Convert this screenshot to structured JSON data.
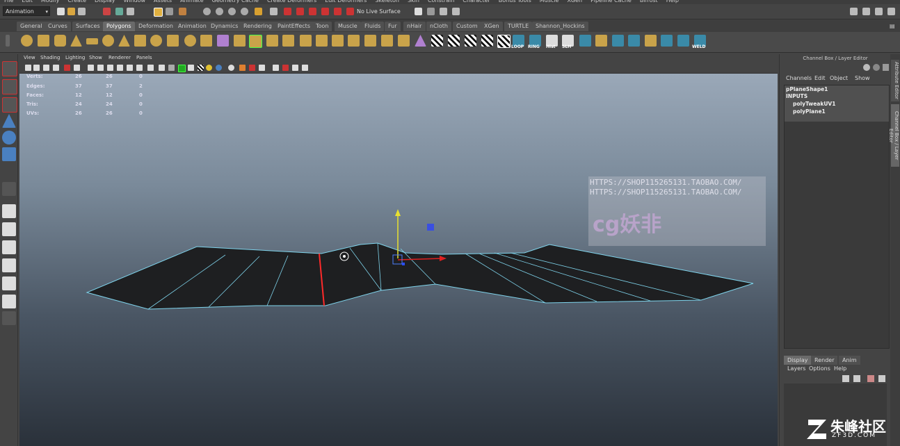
{
  "menubar": [
    "File",
    "Edit",
    "Modify",
    "Create",
    "Display",
    "Window",
    "Assets",
    "Animate",
    "Geometry Cache",
    "Create Deformers",
    "Edit Deformers",
    "Skeleton",
    "Skin",
    "Constrain",
    "Character",
    "Bonus Tools",
    "Muscle",
    "XGen",
    "Pipeline Cache",
    "Bifrost",
    "Help"
  ],
  "status": {
    "mode": "Animation",
    "live_surface": "No Live Surface"
  },
  "shelf_tabs": [
    "General",
    "Curves",
    "Surfaces",
    "Polygons",
    "Deformation",
    "Animation",
    "Dynamics",
    "Rendering",
    "PaintEffects",
    "Toon",
    "Muscle",
    "Fluids",
    "Fur",
    "nHair",
    "nCloth",
    "Custom",
    "XGen",
    "TURTLE",
    "Shannon_Hockins"
  ],
  "active_shelf_tab": "Polygons",
  "shelf_labels": [
    "LOOP",
    "RING",
    "Hist",
    "SLH",
    "WELD"
  ],
  "viewport_menu": [
    "View",
    "Shading",
    "Lighting",
    "Show",
    "Renderer",
    "Panels"
  ],
  "hud": {
    "rows": [
      {
        "label": "Verts:",
        "a": "26",
        "b": "26",
        "c": "0"
      },
      {
        "label": "Edges:",
        "a": "37",
        "b": "37",
        "c": "2"
      },
      {
        "label": "Faces:",
        "a": "12",
        "b": "12",
        "c": "0"
      },
      {
        "label": "Tris:",
        "a": "24",
        "b": "24",
        "c": "0"
      },
      {
        "label": "UVs:",
        "a": "26",
        "b": "26",
        "c": "0"
      }
    ]
  },
  "watermark": {
    "url1": "HTTPS://SHOP115265131.TAOBAO.COM/",
    "url2": "HTTPS://SHOP115265131.TAOBAO.COM/",
    "logo": "cg妖非"
  },
  "channel_box": {
    "title": "Channel Box / Layer Editor",
    "menu": [
      "Channels",
      "Edit",
      "Object",
      "Show"
    ],
    "items": [
      "pPlaneShape1",
      "INPUTS",
      "polyTweakUV1",
      "polyPlane1"
    ]
  },
  "layer_editor": {
    "tabs": [
      "Display",
      "Render",
      "Anim"
    ],
    "active_tab": "Display",
    "menu": [
      "Layers",
      "Options",
      "Help"
    ]
  },
  "side_tabs": [
    "Attribute Editor",
    "Channel Box / Layer Editor"
  ],
  "corner_logo": {
    "name": "朱峰社区",
    "domain": "ZF3D.COM"
  }
}
